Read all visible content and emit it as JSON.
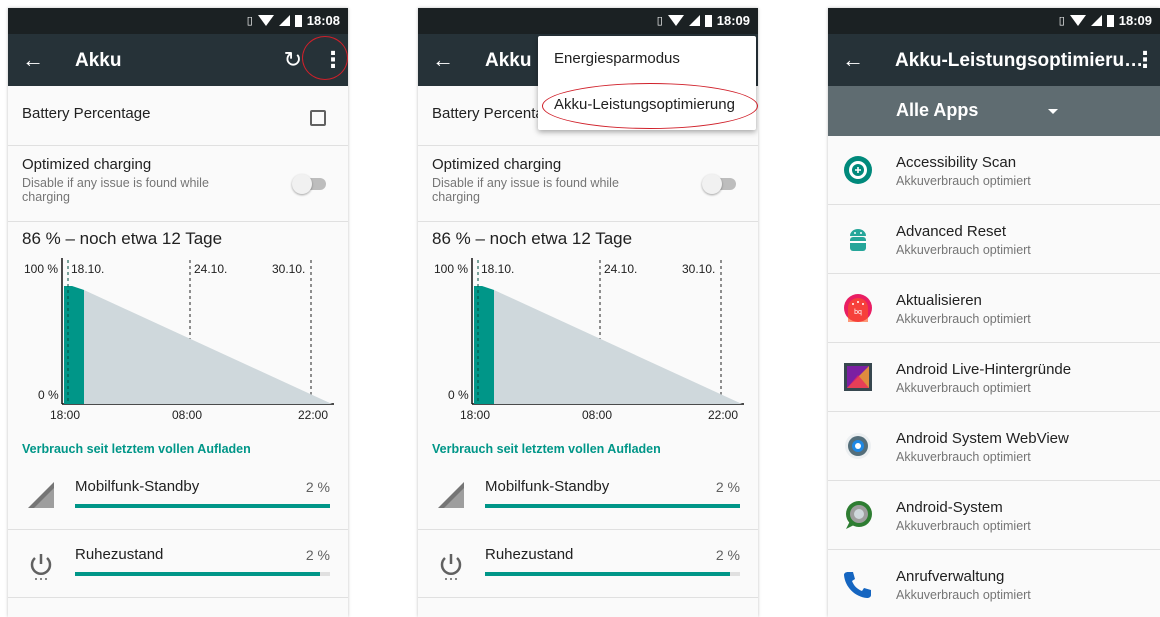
{
  "status_bar": {
    "screen1_time": "18:08",
    "screen2_time": "18:09",
    "screen3_time": "18:09"
  },
  "screen1": {
    "title": "Akku",
    "battery_percentage_label": "Battery Percentage",
    "optimized_charging": {
      "title": "Optimized charging",
      "subtitle": "Disable if any issue is found while charging",
      "enabled": false
    },
    "summary": "86 % – noch etwa 12 Tage",
    "section_header": "Verbrauch seit letztem vollen Aufladen",
    "usage": [
      {
        "name": "Mobilfunk-Standby",
        "percent_text": "2 %",
        "bar_fraction": 1.0
      },
      {
        "name": "Ruhezustand",
        "percent_text": "2 %",
        "bar_fraction": 0.96
      }
    ]
  },
  "chart": {
    "y_top_label": "100 %",
    "y_bottom_label": "0 %",
    "date_labels": [
      "18.10.",
      "24.10.",
      "30.10."
    ],
    "time_labels": [
      "18:00",
      "08:00",
      "22:00"
    ]
  },
  "chart_data": {
    "type": "area",
    "title": "",
    "xlabel": "",
    "ylabel": "",
    "ylim": [
      0,
      100
    ],
    "x_ticks": [
      "18:00",
      "08:00",
      "22:00"
    ],
    "date_markers": [
      "18.10.",
      "24.10.",
      "30.10."
    ],
    "series": [
      {
        "name": "",
        "kind": "measured",
        "color": "#009688",
        "points": [
          [
            0,
            100
          ],
          [
            1,
            98
          ],
          [
            2,
            95
          ]
        ]
      },
      {
        "name": "",
        "kind": "predicted",
        "color": "#cfd8dc",
        "points": [
          [
            2,
            95
          ],
          [
            14,
            0
          ]
        ]
      }
    ]
  },
  "screen2": {
    "title": "Akku",
    "battery_percentage_label": "Battery Percentage",
    "optimized_charging": {
      "title": "Optimized charging",
      "subtitle": "Disable if any issue is found while charging"
    },
    "summary": "86 % – noch etwa 12 Tage",
    "section_header": "Verbrauch seit letztem vollen Aufladen",
    "usage": [
      {
        "name": "Mobilfunk-Standby",
        "percent_text": "2 %"
      },
      {
        "name": "Ruhezustand",
        "percent_text": "2 %"
      }
    ],
    "menu": [
      "Energiesparmodus",
      "Akku-Leistungsoptimierung"
    ]
  },
  "screen3": {
    "title": "Akku-Leistungsoptimieru…",
    "filter_selected": "Alle Apps",
    "apps": [
      {
        "name": "Accessibility Scan",
        "status": "Akkuverbrauch optimiert",
        "icon": "accessibility-scan-icon"
      },
      {
        "name": "Advanced Reset",
        "status": "Akkuverbrauch optimiert",
        "icon": "android-robot-icon"
      },
      {
        "name": "Aktualisieren",
        "status": "Akkuverbrauch optimiert",
        "icon": "bq-update-icon"
      },
      {
        "name": "Android Live-Hintergründe",
        "status": "Akkuverbrauch optimiert",
        "icon": "live-wallpaper-icon"
      },
      {
        "name": "Android System WebView",
        "status": "Akkuverbrauch optimiert",
        "icon": "webview-gear-icon"
      },
      {
        "name": "Android-System",
        "status": "Akkuverbrauch optimiert",
        "icon": "android-system-icon"
      },
      {
        "name": "Anrufverwaltung",
        "status": "Akkuverbrauch optimiert",
        "icon": "phone-handset-icon"
      }
    ]
  },
  "colors": {
    "appbar": "#263238",
    "statusbar": "#1b2123",
    "accent": "#009688",
    "spinner_bar": "#5f6c71",
    "highlight_circle": "#d0202a"
  }
}
